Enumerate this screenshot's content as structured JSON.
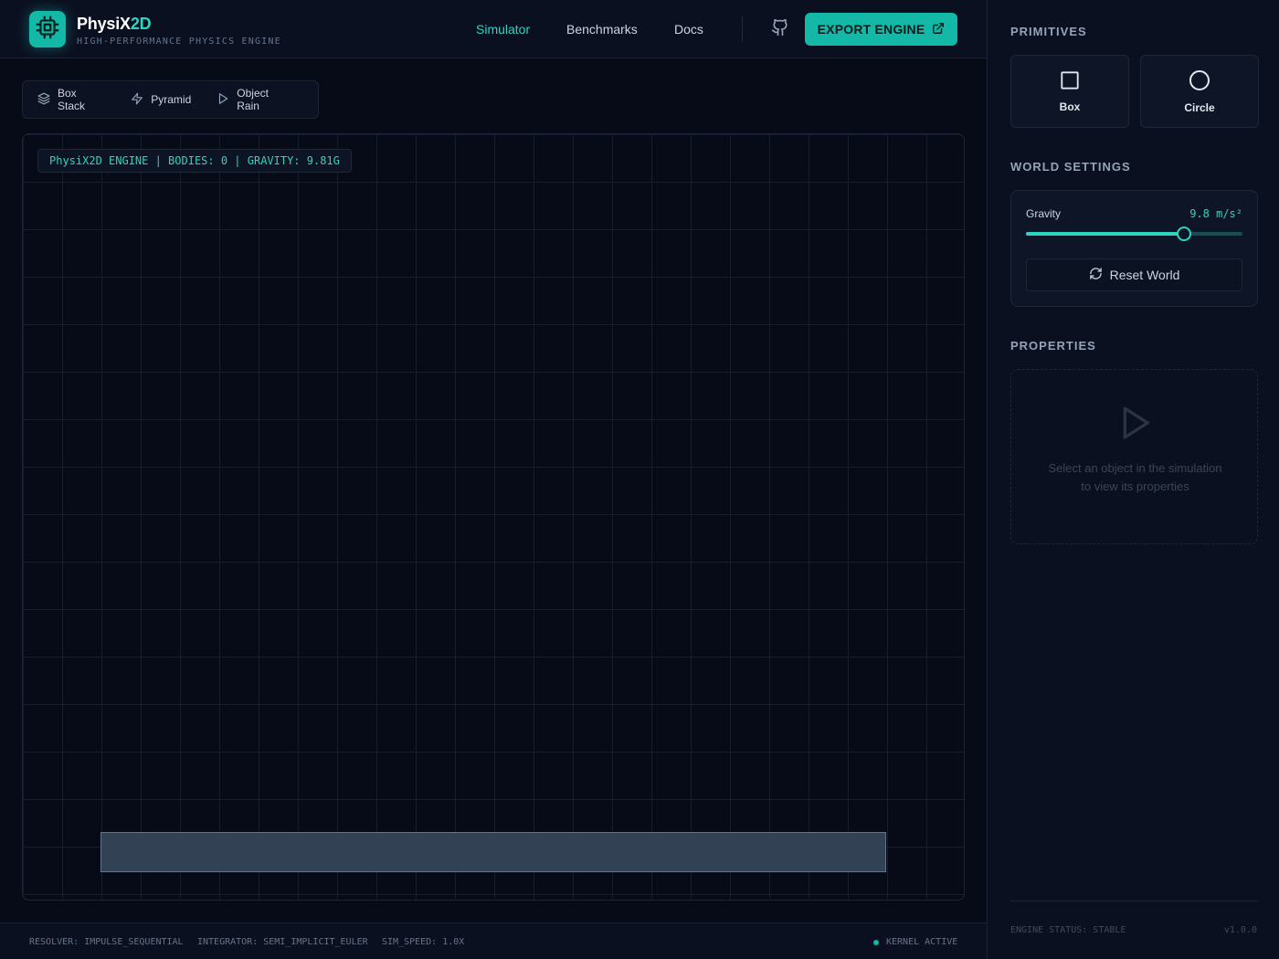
{
  "header": {
    "brand_main": "PhysiX",
    "brand_accent": "2D",
    "tagline": "HIGH-PERFORMANCE PHYSICS ENGINE",
    "logo_icon": "cpu-icon",
    "nav": [
      {
        "label": "Simulator",
        "active": true
      },
      {
        "label": "Benchmarks",
        "active": false
      },
      {
        "label": "Docs",
        "active": false
      }
    ],
    "github_icon": "github-icon",
    "export_label": "EXPORT ENGINE",
    "export_icon": "external-link-icon"
  },
  "presets": [
    {
      "label": "Box Stack",
      "icon": "layers-icon"
    },
    {
      "label": "Pyramid",
      "icon": "lightning-icon"
    },
    {
      "label": "Object Rain",
      "icon": "play-icon"
    }
  ],
  "canvas": {
    "hud": "PhysiX2D ENGINE | BODIES: 0 | GRAVITY: 9.81G"
  },
  "footer": {
    "resolver": "RESOLVER: IMPULSE_SEQUENTIAL",
    "integrator": "INTEGRATOR: SEMI_IMPLICIT_EULER",
    "sim_speed": "SIM_SPEED: 1.0X",
    "kernel": "KERNEL ACTIVE"
  },
  "panel": {
    "primitives_title": "PRIMITIVES",
    "primitives": [
      {
        "label": "Box",
        "icon": "square-icon"
      },
      {
        "label": "Circle",
        "icon": "circle-icon"
      }
    ],
    "world_title": "WORLD SETTINGS",
    "gravity_label": "Gravity",
    "gravity_value": "9.8 m/s²",
    "gravity_fraction": 0.73,
    "reset_label": "Reset World",
    "properties_title": "PROPERTIES",
    "properties_empty": "Select an object in the simulation to view its properties",
    "engine_status": "ENGINE STATUS: STABLE",
    "version": "v1.0.0"
  },
  "colors": {
    "accent": "#14b8a6",
    "accent_light": "#2dd4bf",
    "background": "#070b17"
  }
}
